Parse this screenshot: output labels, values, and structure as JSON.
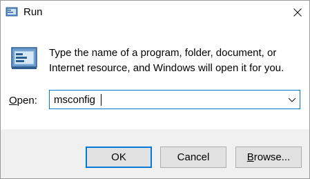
{
  "window": {
    "title": "Run",
    "title_icon": "run-icon",
    "close_icon": "close-icon"
  },
  "body": {
    "icon": "run-icon",
    "description": "Type the name of a program, folder, document, or Internet resource, and Windows will open it for you."
  },
  "open_field": {
    "label_accel": "O",
    "label_rest": "pen:",
    "value": "msconfig",
    "dropdown_icon": "chevron-down-icon"
  },
  "buttons": {
    "ok": "OK",
    "cancel": "Cancel",
    "browse_accel": "B",
    "browse_rest": "rowse..."
  },
  "colors": {
    "accent": "#0078d7",
    "footer_bg": "#f0f0f0",
    "button_bg": "#e1e1e1"
  }
}
